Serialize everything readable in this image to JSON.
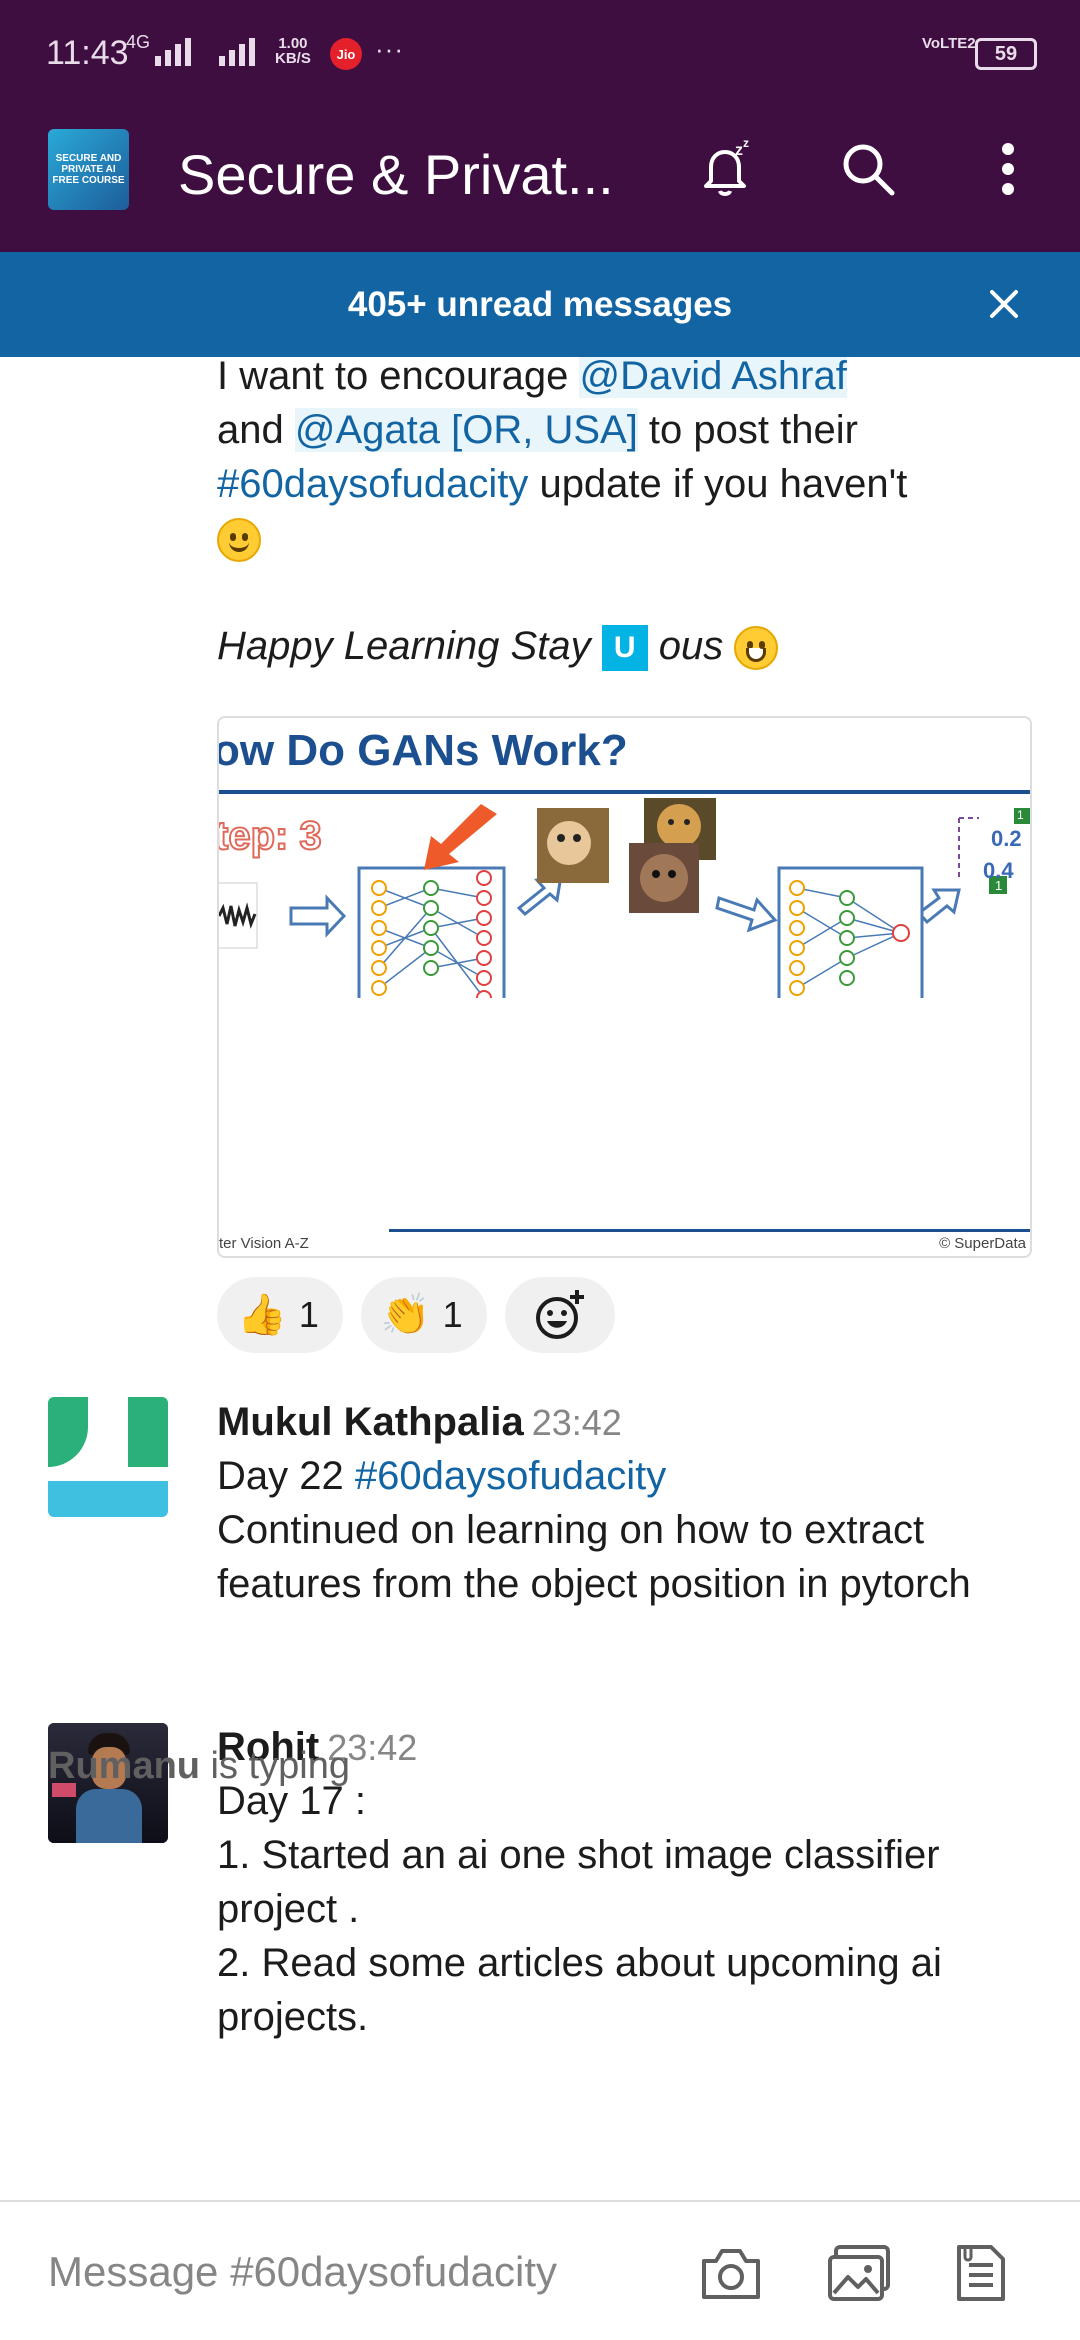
{
  "status_bar": {
    "time": "11:43",
    "network": "4G",
    "speed_value": "1.00",
    "speed_unit": "KB/S",
    "carrier_badge": "Jio",
    "overflow": "···",
    "volte": "VoLTE2",
    "battery": "59"
  },
  "header": {
    "channel_avatar_text": "SECURE AND PRIVATE AI FREE COURSE",
    "channel_title": "Secure & Privat...",
    "icons": [
      "snooze-bell-icon",
      "search-icon",
      "more-vert-icon"
    ]
  },
  "banner": {
    "text": "405+ unread messages"
  },
  "message1": {
    "line1_pre": "I want to encourage ",
    "mention1": "@David Ashraf",
    "line2_pre": "and ",
    "mention2": "@Agata [OR, USA]",
    "line2_post": " to post their",
    "hashtag": "#60daysofudacity",
    "line3_post": " update if you haven't",
    "happy_pre": "Happy Learning Stay ",
    "udacity_glyph": "U",
    "happy_post": " ous",
    "attachment": {
      "title": "ow Do GANs Work?",
      "step": "tep: 3",
      "values": [
        "0.2",
        "0.4"
      ],
      "value_badges": [
        "1",
        "1"
      ],
      "footer_left": "ter Vision A-Z",
      "footer_right": "© SuperData"
    },
    "reactions": [
      {
        "icon": "thumbs-up-icon",
        "glyph": "👍",
        "count": "1"
      },
      {
        "icon": "clapping-hands-icon",
        "glyph": "👏",
        "count": "1"
      }
    ]
  },
  "message2": {
    "author": "Mukul Kathpalia",
    "time": "23:42",
    "day": "Day 22 ",
    "hashtag": "#60daysofudacity",
    "body": "Continued on learning on how to extract features from the object position in pytorch"
  },
  "message3": {
    "author": "Rohit",
    "time": "23:42",
    "lines": [
      "Day 17 :",
      "1. Started an ai one shot image classifier project .",
      "2. Read some articles about upcoming ai projects."
    ]
  },
  "typing": {
    "user": "Rumanu",
    "text": " is typing"
  },
  "composer": {
    "placeholder": "Message #60daysofudacity",
    "icons": [
      "camera-icon",
      "gallery-icon",
      "files-icon"
    ]
  },
  "colors": {
    "aubergine": "#3f0e40",
    "banner_blue": "#1264a3",
    "link_blue": "#1264a3"
  }
}
